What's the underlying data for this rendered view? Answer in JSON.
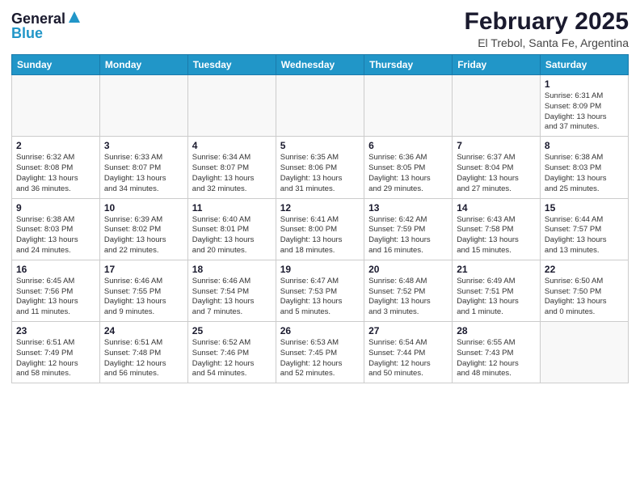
{
  "header": {
    "logo_line1": "General",
    "logo_line2": "Blue",
    "title": "February 2025",
    "subtitle": "El Trebol, Santa Fe, Argentina"
  },
  "weekdays": [
    "Sunday",
    "Monday",
    "Tuesday",
    "Wednesday",
    "Thursday",
    "Friday",
    "Saturday"
  ],
  "weeks": [
    [
      {
        "day": "",
        "info": ""
      },
      {
        "day": "",
        "info": ""
      },
      {
        "day": "",
        "info": ""
      },
      {
        "day": "",
        "info": ""
      },
      {
        "day": "",
        "info": ""
      },
      {
        "day": "",
        "info": ""
      },
      {
        "day": "1",
        "info": "Sunrise: 6:31 AM\nSunset: 8:09 PM\nDaylight: 13 hours\nand 37 minutes."
      }
    ],
    [
      {
        "day": "2",
        "info": "Sunrise: 6:32 AM\nSunset: 8:08 PM\nDaylight: 13 hours\nand 36 minutes."
      },
      {
        "day": "3",
        "info": "Sunrise: 6:33 AM\nSunset: 8:07 PM\nDaylight: 13 hours\nand 34 minutes."
      },
      {
        "day": "4",
        "info": "Sunrise: 6:34 AM\nSunset: 8:07 PM\nDaylight: 13 hours\nand 32 minutes."
      },
      {
        "day": "5",
        "info": "Sunrise: 6:35 AM\nSunset: 8:06 PM\nDaylight: 13 hours\nand 31 minutes."
      },
      {
        "day": "6",
        "info": "Sunrise: 6:36 AM\nSunset: 8:05 PM\nDaylight: 13 hours\nand 29 minutes."
      },
      {
        "day": "7",
        "info": "Sunrise: 6:37 AM\nSunset: 8:04 PM\nDaylight: 13 hours\nand 27 minutes."
      },
      {
        "day": "8",
        "info": "Sunrise: 6:38 AM\nSunset: 8:03 PM\nDaylight: 13 hours\nand 25 minutes."
      }
    ],
    [
      {
        "day": "9",
        "info": "Sunrise: 6:38 AM\nSunset: 8:03 PM\nDaylight: 13 hours\nand 24 minutes."
      },
      {
        "day": "10",
        "info": "Sunrise: 6:39 AM\nSunset: 8:02 PM\nDaylight: 13 hours\nand 22 minutes."
      },
      {
        "day": "11",
        "info": "Sunrise: 6:40 AM\nSunset: 8:01 PM\nDaylight: 13 hours\nand 20 minutes."
      },
      {
        "day": "12",
        "info": "Sunrise: 6:41 AM\nSunset: 8:00 PM\nDaylight: 13 hours\nand 18 minutes."
      },
      {
        "day": "13",
        "info": "Sunrise: 6:42 AM\nSunset: 7:59 PM\nDaylight: 13 hours\nand 16 minutes."
      },
      {
        "day": "14",
        "info": "Sunrise: 6:43 AM\nSunset: 7:58 PM\nDaylight: 13 hours\nand 15 minutes."
      },
      {
        "day": "15",
        "info": "Sunrise: 6:44 AM\nSunset: 7:57 PM\nDaylight: 13 hours\nand 13 minutes."
      }
    ],
    [
      {
        "day": "16",
        "info": "Sunrise: 6:45 AM\nSunset: 7:56 PM\nDaylight: 13 hours\nand 11 minutes."
      },
      {
        "day": "17",
        "info": "Sunrise: 6:46 AM\nSunset: 7:55 PM\nDaylight: 13 hours\nand 9 minutes."
      },
      {
        "day": "18",
        "info": "Sunrise: 6:46 AM\nSunset: 7:54 PM\nDaylight: 13 hours\nand 7 minutes."
      },
      {
        "day": "19",
        "info": "Sunrise: 6:47 AM\nSunset: 7:53 PM\nDaylight: 13 hours\nand 5 minutes."
      },
      {
        "day": "20",
        "info": "Sunrise: 6:48 AM\nSunset: 7:52 PM\nDaylight: 13 hours\nand 3 minutes."
      },
      {
        "day": "21",
        "info": "Sunrise: 6:49 AM\nSunset: 7:51 PM\nDaylight: 13 hours\nand 1 minute."
      },
      {
        "day": "22",
        "info": "Sunrise: 6:50 AM\nSunset: 7:50 PM\nDaylight: 13 hours\nand 0 minutes."
      }
    ],
    [
      {
        "day": "23",
        "info": "Sunrise: 6:51 AM\nSunset: 7:49 PM\nDaylight: 12 hours\nand 58 minutes."
      },
      {
        "day": "24",
        "info": "Sunrise: 6:51 AM\nSunset: 7:48 PM\nDaylight: 12 hours\nand 56 minutes."
      },
      {
        "day": "25",
        "info": "Sunrise: 6:52 AM\nSunset: 7:46 PM\nDaylight: 12 hours\nand 54 minutes."
      },
      {
        "day": "26",
        "info": "Sunrise: 6:53 AM\nSunset: 7:45 PM\nDaylight: 12 hours\nand 52 minutes."
      },
      {
        "day": "27",
        "info": "Sunrise: 6:54 AM\nSunset: 7:44 PM\nDaylight: 12 hours\nand 50 minutes."
      },
      {
        "day": "28",
        "info": "Sunrise: 6:55 AM\nSunset: 7:43 PM\nDaylight: 12 hours\nand 48 minutes."
      },
      {
        "day": "",
        "info": ""
      }
    ]
  ]
}
